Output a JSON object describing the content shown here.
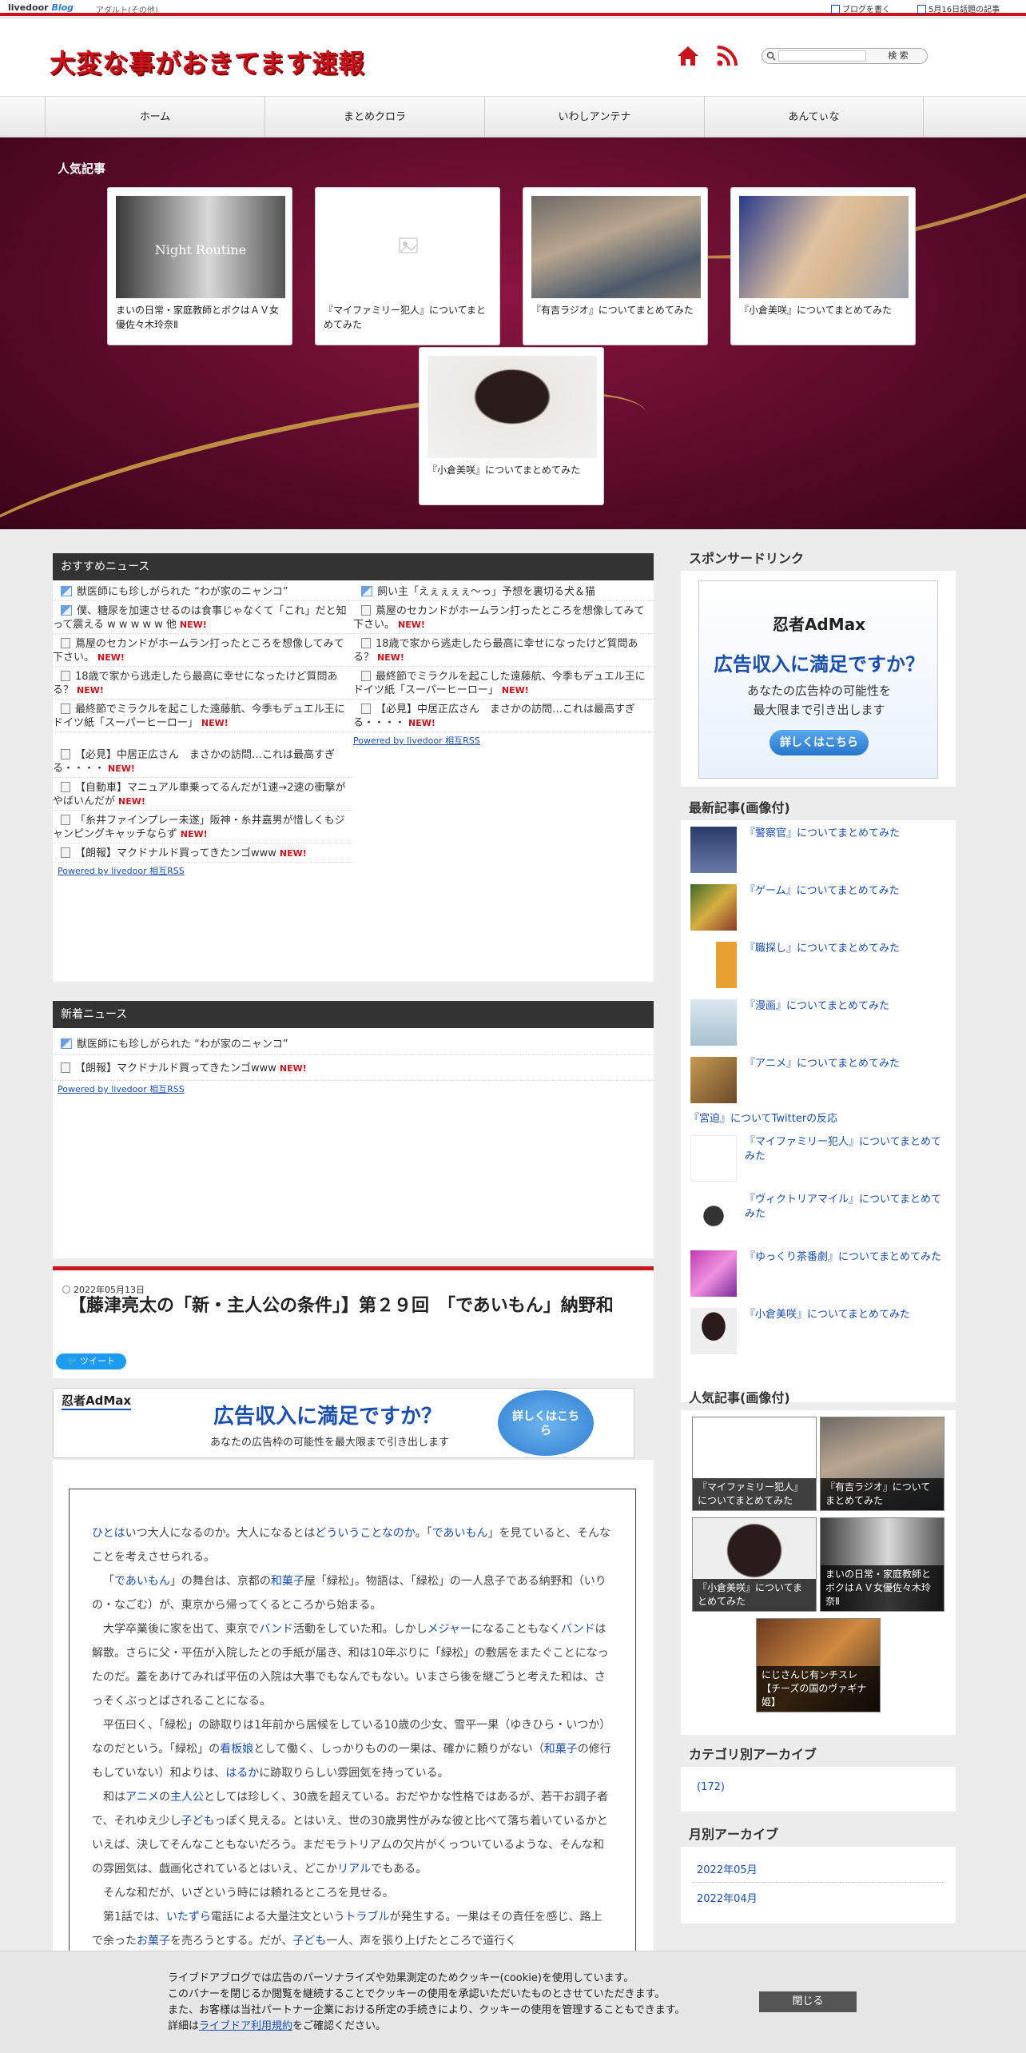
{
  "topbar": {
    "logo": "livedoor",
    "logo_blog": "Blog",
    "category": "アダルト(その他)",
    "write_blog": "ブログを書く",
    "today_topics": "5月16日話題の記事"
  },
  "header": {
    "site_title": "大変な事がおきてます速報",
    "search_placeholder": "",
    "search_button": "検 索"
  },
  "nav": [
    "ホーム",
    "まとめクロラ",
    "いわしアンテナ",
    "あんてぃな"
  ],
  "popular": {
    "heading": "人気記事",
    "cards": [
      {
        "title": "まいの日常・家庭教師とボクはＡＶ女優佐々木玲奈Ⅱ",
        "image_text": "Night Routine"
      },
      {
        "title": "『マイファミリー犯人』についてまとめてみた"
      },
      {
        "title": "『有吉ラジオ』についてまとめてみた"
      },
      {
        "title": "『小倉美咲』についてまとめてみた"
      },
      {
        "title": "『小倉美咲』についてまとめてみた"
      }
    ]
  },
  "recommended": {
    "heading": "おすすめニュース",
    "left": [
      {
        "text": "獣医師にも珍しがられた “わが家のニャンコ”",
        "new": "",
        "icon": "picture-icon"
      },
      {
        "text": "僕、糖尿を加速させるのは食事じゃなくて「これ」だと知って震える w w w w w 他",
        "new": "NEW!",
        "icon": "picture-icon"
      },
      {
        "text": "蔦屋のセカンドがホームラン打ったところを想像してみて下さい。",
        "new": "NEW!",
        "icon": "doc-icon"
      },
      {
        "text": "18歳で家から逃走したら最高に幸せになったけど質問ある？",
        "new": "NEW!",
        "icon": "doc-icon"
      },
      {
        "text": "最終節でミラクルを起こした遠藤航、今季もデュエル王に　ドイツ紙「スーパーヒーロー」",
        "new": "NEW!",
        "icon": "doc-icon"
      },
      {
        "text": "【必見】中居正広さん　まさかの訪問…これは最高すぎる・・・・",
        "new": "NEW!",
        "icon": "doc-icon"
      },
      {
        "text": "【自動車】マニュアル車乗ってるんだが1速→2速の衝撃がやばいんだが",
        "new": "NEW!",
        "icon": "doc-icon"
      },
      {
        "text": "「糸井ファインプレー未遂」阪神・糸井嘉男が惜しくもジャンピングキャッチならず",
        "new": "NEW!",
        "icon": "doc-icon"
      },
      {
        "text": "【朗報】マクドナルド買ってきたンゴwww",
        "new": "NEW!",
        "icon": "doc-icon"
      }
    ],
    "right": [
      {
        "text": "飼い主「えぇぇぇぇ〜っ」予想を裏切る犬＆猫",
        "new": "",
        "icon": "picture-icon"
      },
      {
        "text": "蔦屋のセカンドがホームラン打ったところを想像してみて下さい。",
        "new": "NEW!",
        "icon": "doc-icon"
      },
      {
        "text": "18歳で家から逃走したら最高に幸せになったけど質問ある？",
        "new": "NEW!",
        "icon": "doc-icon"
      },
      {
        "text": "最終節でミラクルを起こした遠藤航、今季もデュエル王に　ドイツ紙「スーパーヒーロー」",
        "new": "NEW!",
        "icon": "doc-icon"
      },
      {
        "text": "【必見】中居正広さん　まさかの訪問…これは最高すぎる・・・・",
        "new": "NEW!",
        "icon": "doc-icon"
      }
    ],
    "powered_left": "Powered by livedoor 相互RSS",
    "powered_right": "Powered by livedoor 相互RSS"
  },
  "new_news": {
    "heading": "新着ニュース",
    "items": [
      {
        "text": "獣医師にも珍しがられた “わが家のニャンコ”",
        "new": ""
      },
      {
        "text": "【朗報】マクドナルド買ってきたンゴwww",
        "new": "NEW!"
      }
    ],
    "powered": "Powered by livedoor 相互RSS"
  },
  "article": {
    "date": "2022年05月13日",
    "title": "【藤津亮太の「新・主人公の条件」】第２９回　「であいもん」納野和",
    "tweet": "ツイート",
    "paragraphs": [
      [
        "ひとは",
        "いつ大人になるのか。大人になるとは",
        "どういうことなのか",
        "。「",
        "であいもん",
        "」を見ていると、そんなことを考えさせられる。"
      ],
      [
        "「",
        "であいもん",
        "」の舞台は、京都の",
        "和菓子",
        "屋「緑松」。物語は、「緑松」の一人息子である納野和（いりの・なごむ）が、東京から帰ってくるところから始まる。"
      ],
      [
        "大学卒業後に家を出て、東京で",
        "バンド",
        "活動をしていた和。しかし",
        "メジャー",
        "になることもなく",
        "バンド",
        "は解散。さらに父・平伍が入院したとの手紙が届き、和は10年ぶりに「緑松」の敷居をまたぐことになったのだ。蓋をあけてみれば平伍の入院は大事でもなんでもない。いまさら後を継ごうと考えた和は、さっそくぶっとばされることになる。"
      ],
      [
        "平伍曰く、「緑松」の跡取りは1年前から居候をしている10歳の少女、雪平一果（ゆきひら・いつか）なのだという。「緑松」の",
        "看板娘",
        "として働く、しっかりものの一果は、確かに頼りがない（",
        "和菓子",
        "の修行もしていない）和よりは、",
        "はるか",
        "に跡取りらしい雰囲気を持っている。"
      ],
      [
        "和は",
        "アニメ",
        "の",
        "主人公",
        "としては珍しく、30歳を超えている。おだやかな性格ではあるが、若干お調子者で、それゆえ少し",
        "子ども",
        "っぽく見える。とはいえ、世の30歳男性がみな彼と比べて落ち着いているかといえば、決してそんなこともないだろう。まだモラトリアムの欠片がくっついているような、そんな和の雰囲気は、戯画化されているとはいえ、どこか",
        "リアル",
        "でもある。"
      ],
      [
        "そんな和だが、いざという時には頼れるところを見せる。"
      ],
      [
        "第1話では、",
        "いたずら",
        "電話による大量注文という",
        "トラブル",
        "が発生する。一果はその責任を感じ、路上で余った",
        "お菓子",
        "を売ろうとする。だが、",
        "子ども",
        "一人、声を張り上げたところで道行く"
      ]
    ]
  },
  "sidebar": {
    "sponsor_heading": "スポンサードリンク",
    "admax": {
      "brand": "忍者AdMax",
      "headline": "広告収入に満足ですか？",
      "sub1": "あなたの広告枠の可能性を",
      "sub2": "最大限まで引き出します",
      "button": "詳しくはこちら"
    },
    "latest_heading": "最新記事(画像付)",
    "latest": [
      "『警察官』についてまとめてみた",
      "『ゲーム』についてまとめてみた",
      "『職探し』についてまとめてみた",
      "『漫画』についてまとめてみた",
      "『アニメ』についてまとめてみた",
      "『宮迫』についてTwitterの反応",
      "『マイファミリー犯人』についてまとめてみた",
      "『ヴィクトリアマイル』についてまとめてみた",
      "『ゆっくり茶番劇』についてまとめてみた",
      "『小倉美咲』についてまとめてみた"
    ],
    "popular_heading": "人気記事(画像付)",
    "popular_tiles": [
      "『マイファミリー犯人』についてまとめてみた",
      "『有吉ラジオ』についてまとめてみた",
      "『小倉美咲』についてまとめてみた",
      "まいの日常・家庭教師とボクはＡＶ女優佐々木玲奈Ⅱ",
      "にじさんじ有ンチスレ【チーズの国のヴァギナ姫】"
    ],
    "category_heading": "カテゴリ別アーカイブ",
    "category_item": "(172)",
    "monthly_heading": "月別アーカイブ",
    "months": [
      "2022年05月",
      "2022年04月"
    ]
  },
  "admax_banner": {
    "brand": "忍者AdMax",
    "headline": "広告収入に満足ですか？",
    "sub": "あなたの広告枠の可能性を最大限まで引き出します",
    "button": "詳しくはこちら"
  },
  "cookie": {
    "line1": "ライブドアブログでは広告のパーソナライズや効果測定のためクッキー(cookie)を使用しています。",
    "line2": "このバナーを閉じるか閲覧を継続することでクッキーの使用を承認いただいたものとさせていただきます。",
    "line3": "また、お客様は当社パートナー企業における所定の手続きにより、クッキーの使用を管理することもできます。",
    "line4_pre": "詳細は",
    "line4_link": "ライブドア利用規約",
    "line4_post": "をご確認ください。",
    "close": "閉じる"
  }
}
